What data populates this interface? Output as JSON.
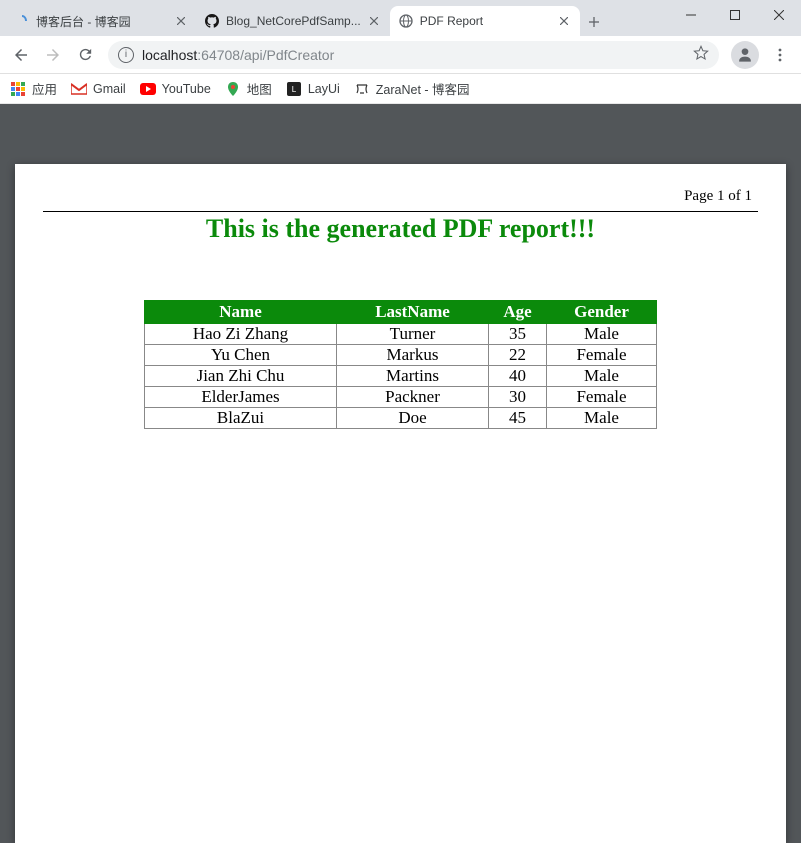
{
  "window": {
    "tabs": [
      {
        "title": "博客后台 - 博客园",
        "favicon": "cnblogs"
      },
      {
        "title": "Blog_NetCorePdfSamp...",
        "favicon": "github"
      },
      {
        "title": "PDF Report",
        "favicon": "globe",
        "active": true
      }
    ]
  },
  "toolbar": {
    "url_host": "localhost",
    "url_port_path": ":64708/api/PdfCreator"
  },
  "bookmarks": {
    "apps_label": "应用",
    "items": [
      {
        "label": "Gmail",
        "icon": "gmail"
      },
      {
        "label": "YouTube",
        "icon": "youtube"
      },
      {
        "label": "地图",
        "icon": "maps"
      },
      {
        "label": "LayUi",
        "icon": "layui"
      },
      {
        "label": "ZaraNet - 博客园",
        "icon": "zaranet"
      }
    ]
  },
  "pdf": {
    "page_indicator": "Page 1 of 1",
    "title": "This is the generated PDF report!!!",
    "headers": {
      "name": "Name",
      "last": "LastName",
      "age": "Age",
      "gender": "Gender"
    },
    "rows": [
      {
        "name": "Hao Zi Zhang",
        "last": "Turner",
        "age": "35",
        "gender": "Male"
      },
      {
        "name": "Yu Chen",
        "last": "Markus",
        "age": "22",
        "gender": "Female"
      },
      {
        "name": "Jian Zhi Chu",
        "last": "Martins",
        "age": "40",
        "gender": "Male"
      },
      {
        "name": "ElderJames",
        "last": "Packner",
        "age": "30",
        "gender": "Female"
      },
      {
        "name": "BlaZui",
        "last": "Doe",
        "age": "45",
        "gender": "Male"
      }
    ]
  }
}
